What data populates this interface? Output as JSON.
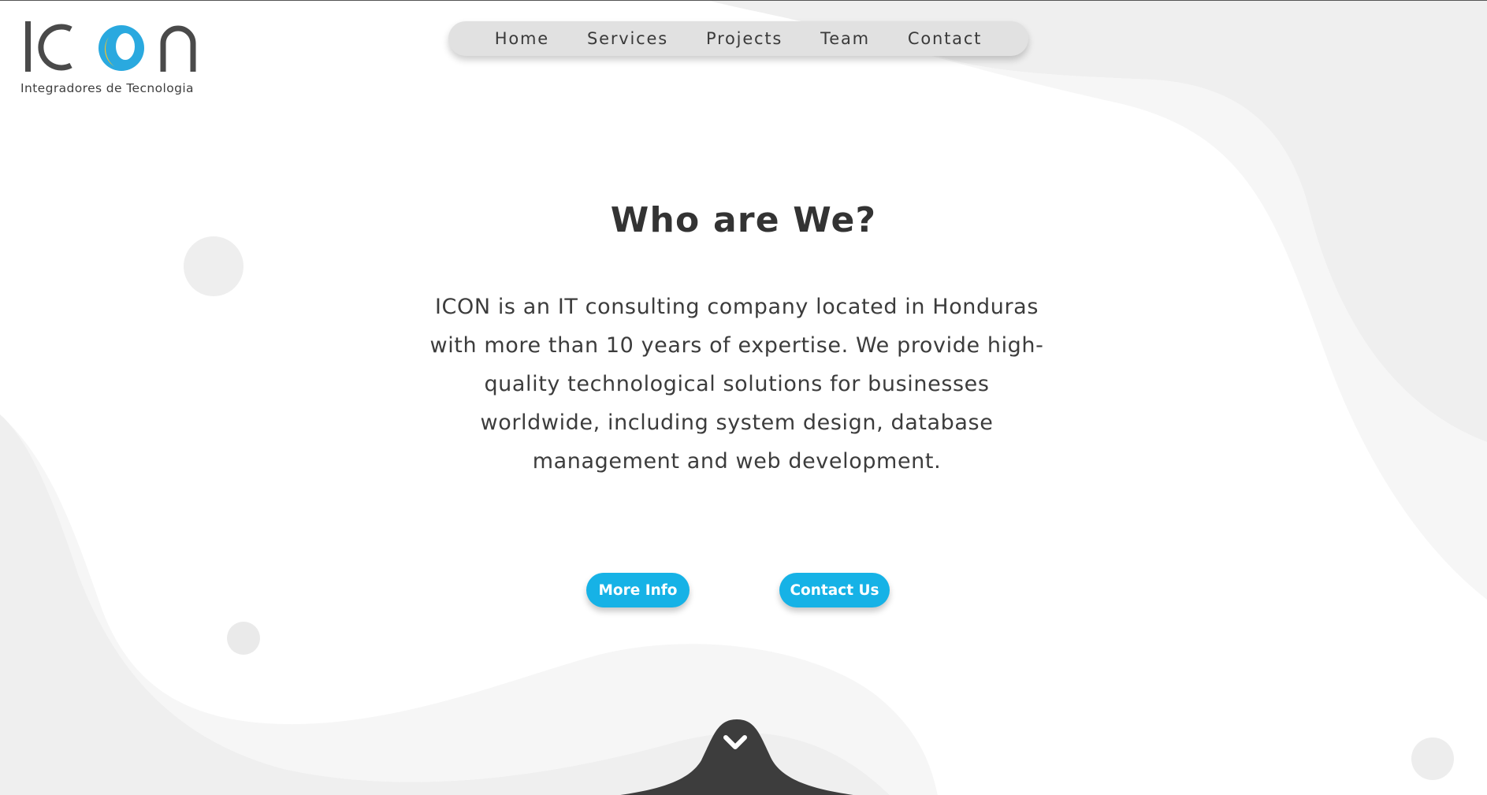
{
  "brand": {
    "logo_text": "ICON",
    "tagline": "Integradores de Tecnologia"
  },
  "nav": {
    "items": [
      {
        "label": "Home"
      },
      {
        "label": "Services"
      },
      {
        "label": "Projects"
      },
      {
        "label": "Team"
      },
      {
        "label": "Contact"
      }
    ]
  },
  "hero": {
    "title": "Who are We?",
    "description": "ICON is an IT consulting company located in Honduras with more than 10 years of expertise. We provide high-quality technological solutions for businesses worldwide, including system design, database management and web development.",
    "more_info_label": "More Info",
    "contact_label": "Contact Us"
  },
  "icons": {
    "scroll": "chevron-down-icon"
  },
  "colors": {
    "accent": "#16b2e6",
    "logo_yellow": "#f2c22d",
    "logo_blue": "#2aa9df",
    "text_dark": "#333333",
    "nav_bg": "#e1e1e1",
    "wave_light": "#efefef",
    "wave_lighter": "#f6f6f6",
    "scroll_tab": "#3d3d3d"
  }
}
